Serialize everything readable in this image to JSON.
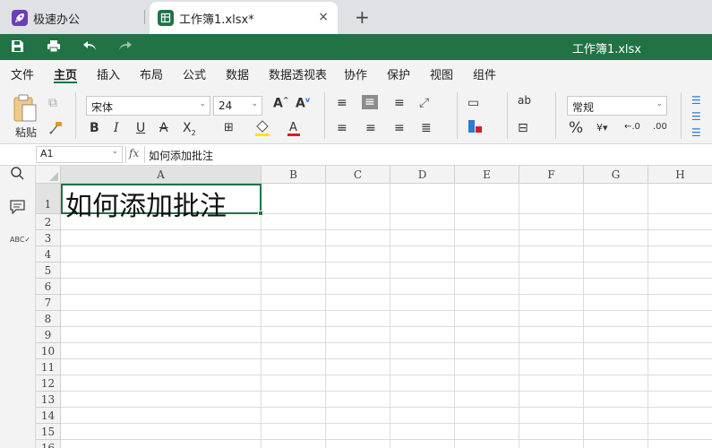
{
  "tabs": {
    "home_label": "极速办公",
    "book_label": "工作簿1.xlsx*",
    "close": "×",
    "new_tab": "+"
  },
  "colors": {
    "brand_green": "#217346",
    "home_icon_purple": "#6b3fb3",
    "selection_green": "#217346"
  },
  "toolbar": {
    "doc_title": "工作簿1.xlsx",
    "icons": [
      "save-icon",
      "print-icon",
      "undo-icon",
      "redo-icon"
    ]
  },
  "menu": {
    "items": [
      "文件",
      "主页",
      "插入",
      "布局",
      "公式",
      "数据",
      "数据透视表",
      "协作",
      "保护",
      "视图",
      "组件"
    ],
    "active": "主页"
  },
  "ribbon": {
    "paste_label": "粘贴",
    "font_name": "宋体",
    "font_size": "24",
    "number_format": "常规",
    "percent": "%"
  },
  "formula_bar": {
    "cell_ref": "A1",
    "fx": "fx",
    "content": "如何添加批注"
  },
  "sheet": {
    "columns": [
      "A",
      "B",
      "C",
      "D",
      "E",
      "F",
      "G",
      "H"
    ],
    "rows": [
      "1",
      "2",
      "3",
      "4",
      "5",
      "6",
      "7",
      "8",
      "9",
      "10",
      "11",
      "12",
      "13",
      "14",
      "15",
      "16"
    ],
    "a1_value": "如何添加批注",
    "selected_cell": "A1"
  }
}
